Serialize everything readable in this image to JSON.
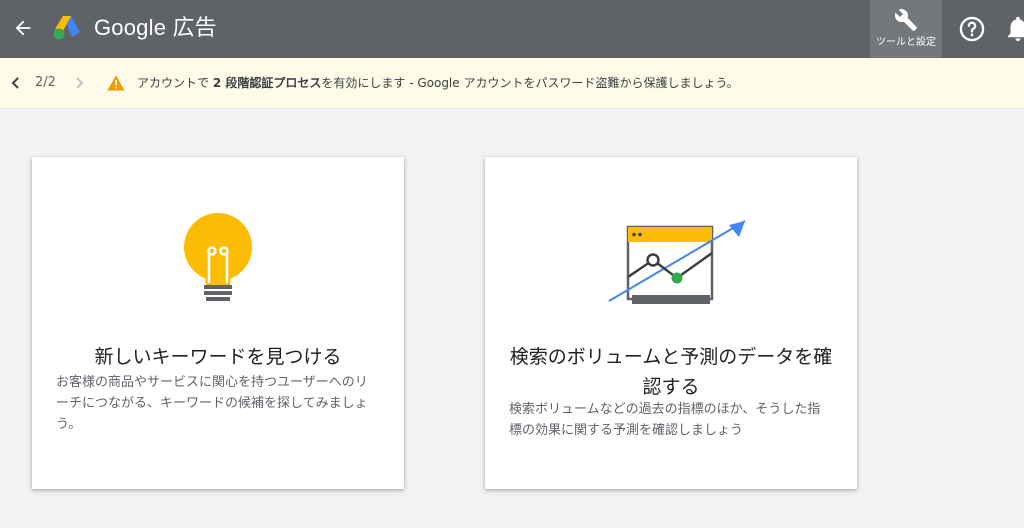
{
  "header": {
    "brand_name": "Google 広告",
    "tools_label": "ツールと設定",
    "icons": {
      "back": "arrow-back-icon",
      "logo": "google-ads-logo",
      "tools": "wrench-icon",
      "help": "help-circle-icon",
      "notifications": "bell-icon"
    },
    "colors": {
      "bar": "#5f6368",
      "tools_active": "#74777b"
    }
  },
  "banner": {
    "pager": "2/2",
    "message_before": "アカウントで",
    "message_bold": "2 段階認証プロセス",
    "message_after": "を有効にします - Google アカウントをパスワード盗難から保護しましょう。",
    "icons": {
      "prev": "chevron-left-icon",
      "next": "chevron-right-icon",
      "warning": "warning-triangle-icon"
    },
    "colors": {
      "background": "#fefbe8",
      "warning": "#f29900"
    }
  },
  "cards": [
    {
      "title": "新しいキーワードを見つける",
      "description": "お客様の商品やサービスに関心を持つユーザーへのリーチにつながる、キーワードの候補を探してみましょう。",
      "illustration": "lightbulb-icon"
    },
    {
      "title": "検索のボリュームと予測のデータを確認する",
      "description": "検索ボリュームなどの過去の指標のほか、そうした指標の効果に関する予測を確認しましょう",
      "illustration": "trend-chart-illustration"
    }
  ]
}
